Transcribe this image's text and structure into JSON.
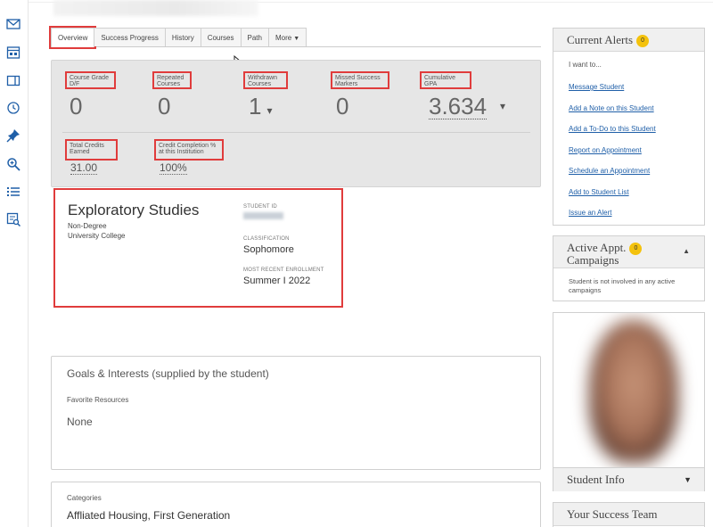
{
  "tabs": [
    {
      "label": "Overview"
    },
    {
      "label": "Success Progress"
    },
    {
      "label": "History"
    },
    {
      "label": "Courses"
    },
    {
      "label": "Path"
    },
    {
      "label": "More"
    }
  ],
  "metrics": {
    "course_grade": {
      "label": "Course Grade D/F",
      "value": "0"
    },
    "repeated": {
      "label": "Repeated Courses",
      "value": "0"
    },
    "withdrawn": {
      "label": "Withdrawn Courses",
      "value": "1"
    },
    "missed": {
      "label": "Missed Success Markers",
      "value": "0"
    },
    "gpa": {
      "label": "Cumulative GPA",
      "value": "3.634"
    },
    "credits": {
      "label": "Total Credits Earned",
      "value": "31.00"
    },
    "completion": {
      "label": "Credit Completion % at this Institution",
      "value": "100%"
    }
  },
  "program": {
    "major": "Exploratory Studies",
    "degree": "Non-Degree",
    "college": "University College",
    "student_id_label": "STUDENT ID",
    "classification_label": "CLASSIFICATION",
    "classification": "Sophomore",
    "enrollment_label": "MOST RECENT ENROLLMENT",
    "enrollment": "Summer I 2022"
  },
  "goals": {
    "heading": "Goals & Interests (supplied by the student)",
    "resources_label": "Favorite Resources",
    "resources_value": "None"
  },
  "categories": {
    "label": "Categories",
    "value": "Affliated Housing, First Generation"
  },
  "alerts": {
    "title": "Current Alerts",
    "count": "0",
    "intro": "I want to...",
    "links": [
      "Message Student",
      "Add a Note on this Student",
      "Add a To-Do to this Student",
      "Report on Appointment",
      "Schedule an Appointment",
      "Add to Student List",
      "Issue an Alert"
    ]
  },
  "campaigns": {
    "title_line1": "Active Appt.",
    "title_line2": "Campaigns",
    "count": "0",
    "text": "Student is not involved in any active campaigns"
  },
  "student_info": {
    "title": "Student Info"
  },
  "team": {
    "title": "Your Success Team"
  },
  "icons": {
    "accent": "#1f5fa8",
    "alert_badge": "#f4c20d",
    "highlight": "#e03c3c"
  }
}
